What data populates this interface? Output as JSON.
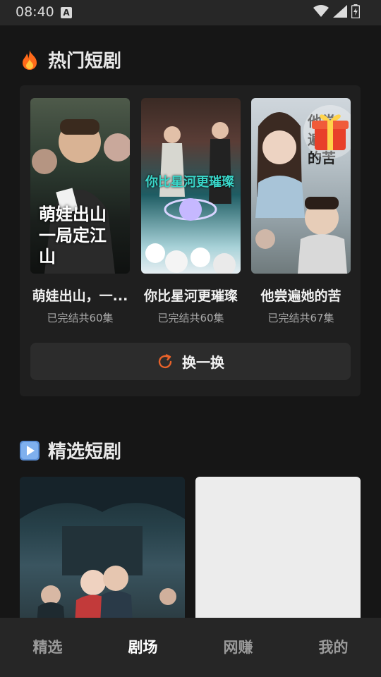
{
  "status": {
    "time": "08:40",
    "notif_letter": "A"
  },
  "hot": {
    "title": "热门短剧",
    "icon": "fire-icon",
    "items": [
      {
        "name": "萌娃出山，一...",
        "sub": "已完结共60集",
        "poster_text": "萌娃出山 一局定江山"
      },
      {
        "name": "你比星河更璀璨",
        "sub": "已完结共60集",
        "poster_text": "你比星河更璀璨"
      },
      {
        "name": "他尝遍她的苦",
        "sub": "已完结共67集",
        "poster_text": "他尝遍她的苦"
      }
    ],
    "refresh_label": "换一换"
  },
  "selected": {
    "title": "精选短剧",
    "icon": "play-icon"
  },
  "tabs": [
    {
      "label": "精选",
      "active": false
    },
    {
      "label": "剧场",
      "active": true
    },
    {
      "label": "网赚",
      "active": false
    },
    {
      "label": "我的",
      "active": false
    }
  ],
  "colors": {
    "accent": "#e8622a",
    "background": "#161616",
    "panel": "#1f1f1f"
  }
}
